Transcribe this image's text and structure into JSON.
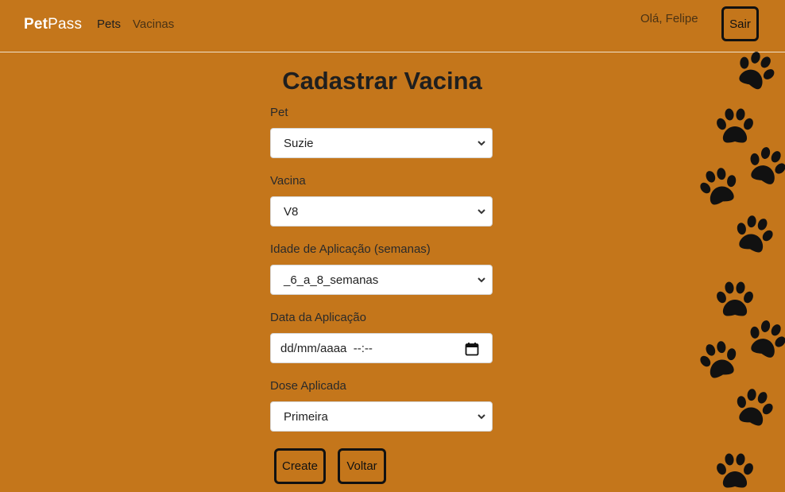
{
  "navbar": {
    "brand_bold": "Pet",
    "brand_light": "Pass",
    "links": [
      "Pets",
      "Vacinas"
    ],
    "greeting": "Olá, Felipe",
    "logout_label": "Sair"
  },
  "form": {
    "title": "Cadastrar Vacina",
    "pet_label": "Pet",
    "pet_value": "Suzie",
    "vaccine_label": "Vacina",
    "vaccine_value": "V8",
    "age_label": "Idade de Aplicação (semanas)",
    "age_value": "_6_a_8_semanas",
    "date_label": "Data da Aplicação",
    "date_placeholder": "dd/mm/aaaa  --:--",
    "dose_label": "Dose Aplicada",
    "dose_value": "Primeira",
    "create_label": "Create",
    "back_label": "Voltar"
  },
  "colors": {
    "background": "#c4761b",
    "border": "#111111"
  },
  "decoration": {
    "icon": "paw-print-icon"
  }
}
